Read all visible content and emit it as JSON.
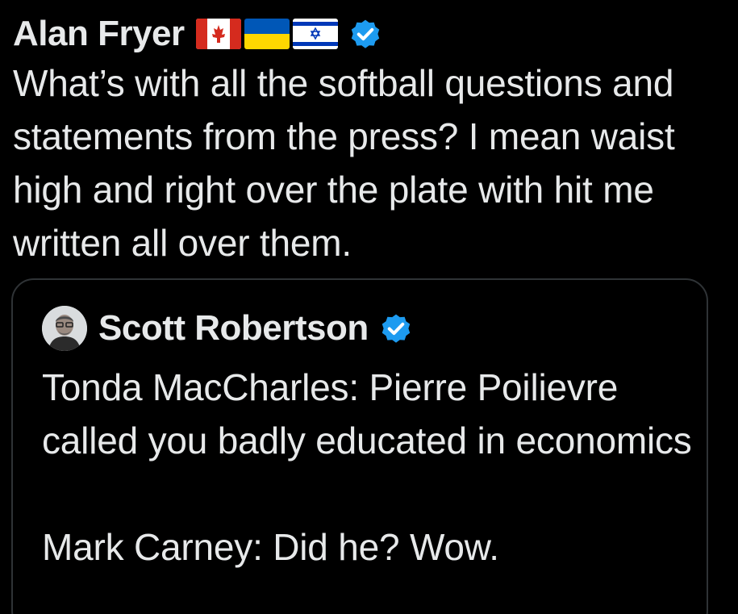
{
  "tweet": {
    "author_name": "Alan Fryer",
    "flags": [
      "canada-flag",
      "ukraine-flag",
      "israel-flag"
    ],
    "verified_icon": "verified-badge-icon",
    "text": "What’s with all the softball questions and statements from the press? I mean waist high and right over the plate with hit me written all over them."
  },
  "quote": {
    "author_name": "Scott Robertson",
    "avatar_icon": "avatar",
    "verified_icon": "verified-badge-icon",
    "text": "Tonda MacCharles: Pierre Poilievre called you badly educated in economics\n\nMark Carney: Did he? Wow."
  },
  "colors": {
    "background": "#000000",
    "text": "#e7e9ea",
    "border": "#2f3336",
    "verified": "#1d9bf0"
  }
}
